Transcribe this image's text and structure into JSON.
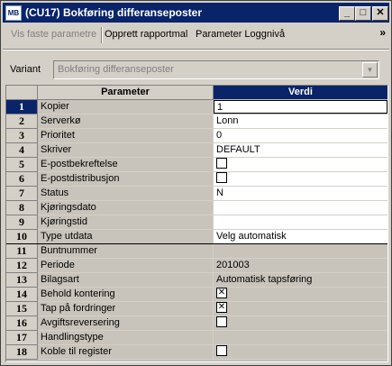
{
  "window": {
    "icon_text": "MB",
    "title": "(CU17) Bokføring differanseposter",
    "controls": {
      "minimize": "_",
      "maximize": "□",
      "close": "✕"
    }
  },
  "toolbar": {
    "items": [
      "Vis faste parametre",
      "Opprett rapportmal",
      "Parameter Loggnivå"
    ],
    "overflow": "»"
  },
  "variant": {
    "label": "Variant",
    "value": "Bokføring differanseposter"
  },
  "grid": {
    "headers": {
      "parameter": "Parameter",
      "value": "Verdi"
    },
    "rows": [
      {
        "num": "1",
        "name": "Kopier",
        "value": "1",
        "type": "text"
      },
      {
        "num": "2",
        "name": "Serverkø",
        "value": "Lonn",
        "type": "text"
      },
      {
        "num": "3",
        "name": "Prioritet",
        "value": "0",
        "type": "text"
      },
      {
        "num": "4",
        "name": "Skriver",
        "value": "DEFAULT",
        "type": "text"
      },
      {
        "num": "5",
        "name": "E-postbekreftelse",
        "value": "",
        "type": "checkbox",
        "checked": false
      },
      {
        "num": "6",
        "name": "E-postdistribusjon",
        "value": "",
        "type": "checkbox",
        "checked": false
      },
      {
        "num": "7",
        "name": "Status",
        "value": "N",
        "type": "text"
      },
      {
        "num": "8",
        "name": "Kjøringsdato",
        "value": "",
        "type": "text"
      },
      {
        "num": "9",
        "name": "Kjøringstid",
        "value": "",
        "type": "text"
      },
      {
        "num": "10",
        "name": "Type utdata",
        "value": "Velg automatisk",
        "type": "text"
      },
      {
        "num": "11",
        "name": "Buntnummer",
        "value": "",
        "type": "readonly"
      },
      {
        "num": "12",
        "name": "Periode",
        "value": "201003",
        "type": "text"
      },
      {
        "num": "13",
        "name": "Bilagsart",
        "value": "Automatisk tapsføring",
        "type": "readonly"
      },
      {
        "num": "14",
        "name": "Behold kontering",
        "value": "",
        "type": "checkbox",
        "checked": true
      },
      {
        "num": "15",
        "name": "Tap på fordringer",
        "value": "",
        "type": "checkbox",
        "checked": true
      },
      {
        "num": "16",
        "name": "Avgiftsreversering",
        "value": "",
        "type": "checkbox",
        "checked": false
      },
      {
        "num": "17",
        "name": "Handlingstype",
        "value": "",
        "type": "readonly"
      },
      {
        "num": "18",
        "name": "Koble til register",
        "value": "",
        "type": "checkbox",
        "checked": false
      }
    ]
  }
}
